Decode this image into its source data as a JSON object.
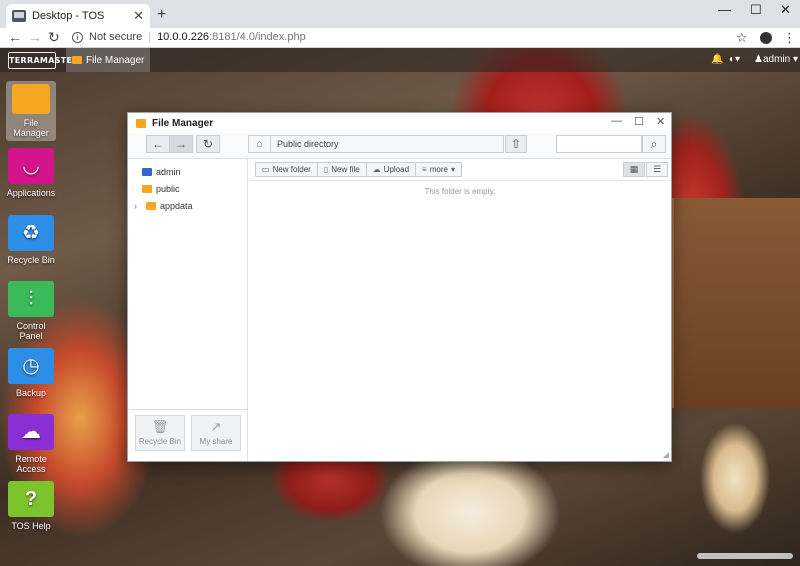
{
  "browser": {
    "tab_title": "Desktop - TOS",
    "tab_close": "✕",
    "new_tab": "+",
    "minimize": "—",
    "maximize": "☐",
    "close": "✕",
    "back": "←",
    "forward": "→",
    "reload": "↻",
    "security_label": "Not secure",
    "url_host": "10.0.0.226",
    "url_path": ":8181/4.0/index.php",
    "bookmark": "☆",
    "menu": "⋮"
  },
  "tos": {
    "logo_text": "TERRAMASTER",
    "task_label": "File Manager",
    "user_label": "admin",
    "desktop_icons": [
      {
        "label": "File Manager",
        "color": "#f5a623"
      },
      {
        "label": "Applications",
        "color": "#d4148c"
      },
      {
        "label": "Recycle Bin",
        "color": "#2d8ee8"
      },
      {
        "label": "Control Panel",
        "color": "#3cb95b"
      },
      {
        "label": "Backup",
        "color": "#2d8ee8"
      },
      {
        "label": "Remote Access",
        "color": "#8a2fd6"
      },
      {
        "label": "TOS Help",
        "color": "#7cc32c"
      }
    ]
  },
  "file_manager": {
    "title": "File Manager",
    "path": "Public directory",
    "tree": [
      {
        "label": "admin",
        "icon_color": "#3366cc"
      },
      {
        "label": "public",
        "icon_color": "#f5a623"
      },
      {
        "label": "appdata",
        "icon_color": "#f5a623"
      }
    ],
    "actions": {
      "new_folder": "New folder",
      "new_file": "New file",
      "upload": "Upload",
      "more": "more"
    },
    "empty_message": "This folder is empty.",
    "side_buttons": {
      "recycle_bin": "Recycle Bin",
      "my_share": "My share"
    }
  }
}
